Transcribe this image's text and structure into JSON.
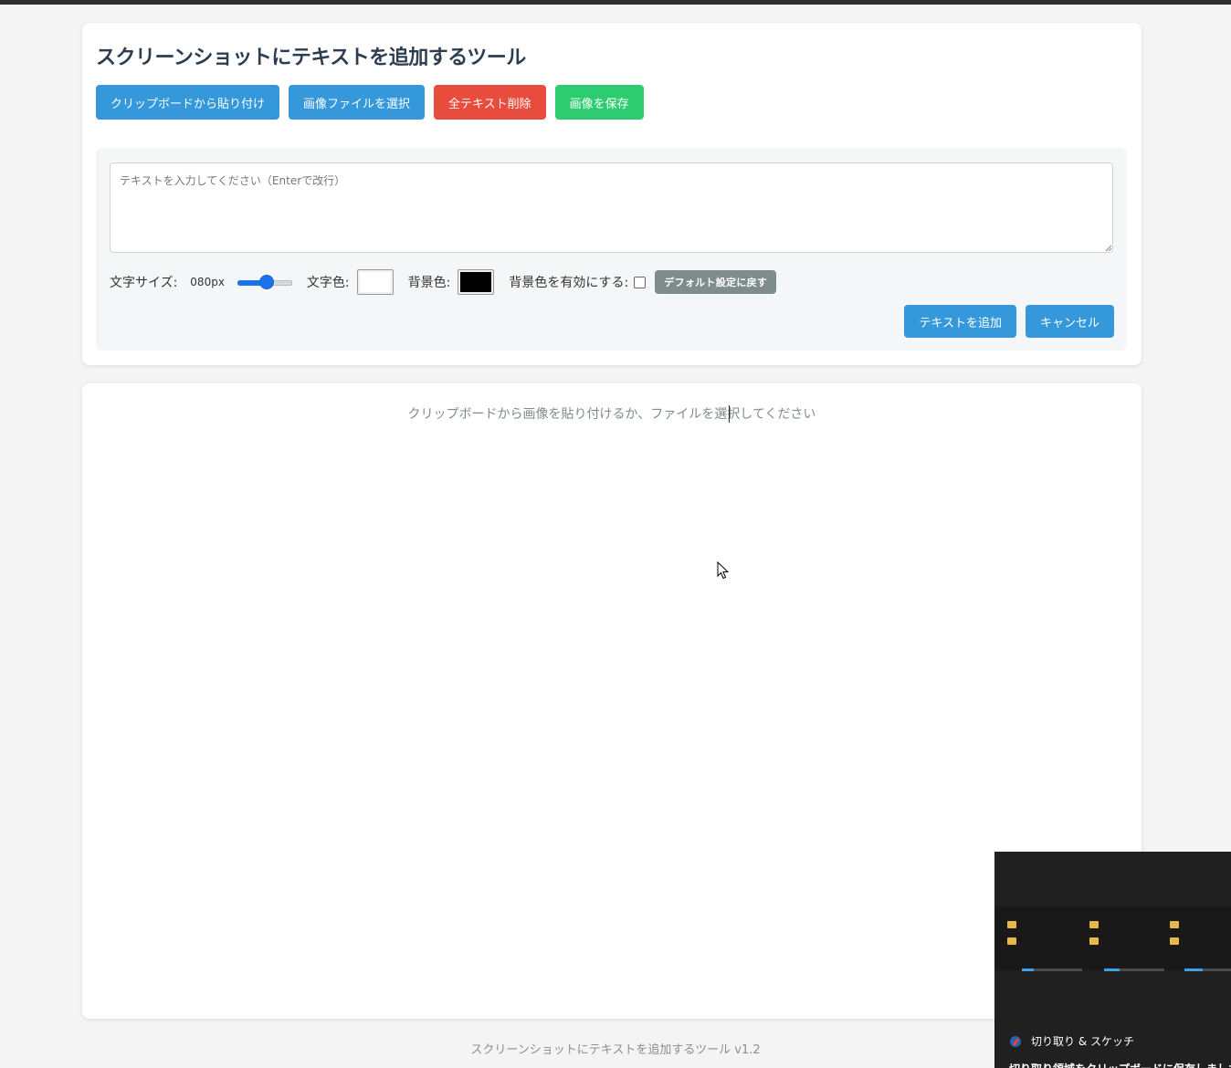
{
  "app": {
    "title": "スクリーンショットにテキストを追加するツール",
    "footer": "スクリーンショットにテキストを追加するツール v1.2"
  },
  "toolbar": {
    "paste_label": "クリップボードから貼り付け",
    "select_file_label": "画像ファイルを選択",
    "delete_all_label": "全テキスト削除",
    "save_label": "画像を保存"
  },
  "editor": {
    "text_placeholder": "テキストを入力してください（Enterで改行）",
    "text_value": "",
    "font_size_label": "文字サイズ:",
    "font_size_value": "080px",
    "font_size_slider_fraction": 0.45,
    "text_color_label": "文字色:",
    "text_color": "#ffffff",
    "bg_color_label": "背景色:",
    "bg_color": "#000000",
    "bg_enable_label": "背景色を有効にする:",
    "bg_enable_checked": false,
    "reset_label": "デフォルト設定に戻す",
    "add_text_label": "テキストを追加",
    "cancel_label": "キャンセル"
  },
  "canvas": {
    "empty_message": "クリップボードから画像を貼り付けるか、ファイルを選択してください"
  },
  "snip_notification": {
    "app_name": "切り取り & スケッチ",
    "message": "切り取り領域をクリップボードに保存しました"
  },
  "colors": {
    "primary": "#3498db",
    "danger": "#e74c3c",
    "success": "#2ecc71",
    "neutral": "#7f8c8d",
    "slider_accent": "#1a73e8"
  }
}
